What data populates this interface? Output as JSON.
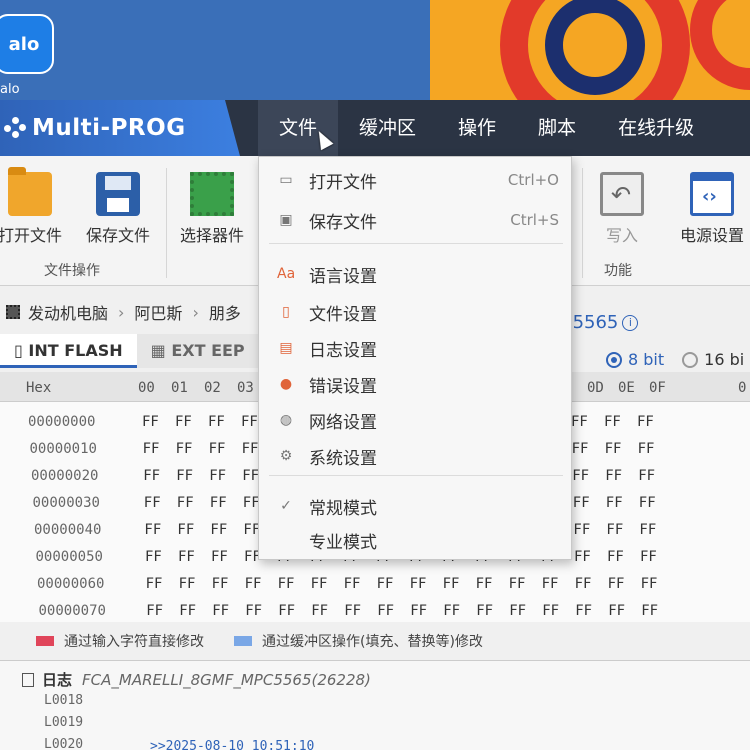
{
  "desktop": {
    "icon_text": "alo",
    "icon_label": "alo"
  },
  "app": {
    "name": "Multi-PROG"
  },
  "menu": [
    {
      "label": "文件",
      "active": true
    },
    {
      "label": "缓冲区"
    },
    {
      "label": "操作"
    },
    {
      "label": "脚本"
    },
    {
      "label": "在线升级"
    }
  ],
  "ribbon": {
    "open_file": "打开文件",
    "save_file": "保存文件",
    "select_device": "选择器件",
    "file_ops_group": "文件操作",
    "write": "写入",
    "power_settings": "电源设置",
    "function_group": "功能"
  },
  "breadcrumb": [
    "发动机电脑",
    "阿巴斯",
    "朋多"
  ],
  "chip_name": "C5565",
  "tabs": [
    "INT FLASH",
    "EXT EEP"
  ],
  "bit_mode": {
    "selected": "8 bit",
    "other": "16 bi"
  },
  "hex": {
    "header_label": "Hex",
    "columns_left": [
      "00",
      "01",
      "02",
      "03"
    ],
    "columns_right": [
      "C",
      "0D",
      "0E",
      "0F"
    ],
    "header_tail": "0",
    "addresses": [
      "00000000",
      "00000010",
      "00000020",
      "00000030",
      "00000040",
      "00000050",
      "00000060",
      "00000070"
    ],
    "fill_value": "FF"
  },
  "legend": {
    "red": "通过输入字符直接修改",
    "blue": "通过缓冲区操作(填充、替换等)修改",
    "red_color": "#e0455a",
    "blue_color": "#7aa7e6"
  },
  "log": {
    "title": "日志",
    "file": "FCA_MARELLI_8GMF_MPC5565(26228)",
    "lines": [
      "L0018",
      "L0019",
      "L0020"
    ],
    "timestamp": ">>2025-08-10 10:51:10"
  },
  "dropdown": {
    "items": [
      {
        "label": "打开文件",
        "shortcut": "Ctrl+O",
        "icon": "folder-icon"
      },
      {
        "label": "保存文件",
        "shortcut": "Ctrl+S",
        "icon": "save-icon"
      },
      {
        "label": "语言设置",
        "icon": "language-icon"
      },
      {
        "label": "文件设置",
        "icon": "file-settings-icon"
      },
      {
        "label": "日志设置",
        "icon": "log-icon"
      },
      {
        "label": "错误设置",
        "icon": "error-icon"
      },
      {
        "label": "网络设置",
        "icon": "globe-icon"
      },
      {
        "label": "系统设置",
        "icon": "gear-icon"
      },
      {
        "label": "常规模式",
        "checked": true,
        "icon": "check-icon"
      },
      {
        "label": "专业模式"
      }
    ]
  },
  "colors": {
    "accent": "#2f63b8",
    "menubar": "#2b3444"
  }
}
